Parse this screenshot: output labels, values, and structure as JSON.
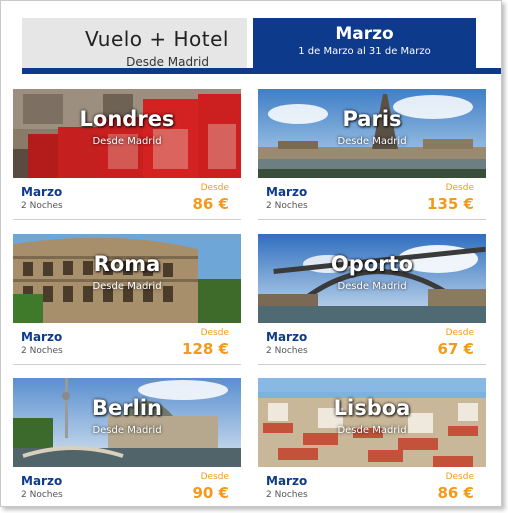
{
  "header": {
    "left_title": "Vuelo + Hotel",
    "left_subtitle": "Desde Madrid",
    "right_title": "Marzo",
    "right_subtitle": "1 de Marzo al 31 de Marzo"
  },
  "colors": {
    "brand_blue": "#0d3a8a",
    "price_orange": "#f29a1b",
    "header_grey": "#e6e6e6"
  },
  "cards": [
    {
      "city": "Londres",
      "from": "Desde Madrid",
      "month": "Marzo",
      "nights": "2 Noches",
      "price_from": "Desde",
      "price": "86 €",
      "photo": "red-phone-boxes"
    },
    {
      "city": "Paris",
      "from": "Desde Madrid",
      "month": "Marzo",
      "nights": "2 Noches",
      "price_from": "Desde",
      "price": "135 €",
      "photo": "eiffel-tower-seine"
    },
    {
      "city": "Roma",
      "from": "Desde Madrid",
      "month": "Marzo",
      "nights": "2 Noches",
      "price_from": "Desde",
      "price": "128 €",
      "photo": "colosseum"
    },
    {
      "city": "Oporto",
      "from": "Desde Madrid",
      "month": "Marzo",
      "nights": "2 Noches",
      "price_from": "Desde",
      "price": "67 €",
      "photo": "dom-luis-bridge"
    },
    {
      "city": "Berlin",
      "from": "Desde Madrid",
      "month": "Marzo",
      "nights": "2 Noches",
      "price_from": "Desde",
      "price": "90 €",
      "photo": "berlin-cathedral"
    },
    {
      "city": "Lisboa",
      "from": "Desde Madrid",
      "month": "Marzo",
      "nights": "2 Noches",
      "price_from": "Desde",
      "price": "86 €",
      "photo": "lisbon-rooftops"
    }
  ]
}
